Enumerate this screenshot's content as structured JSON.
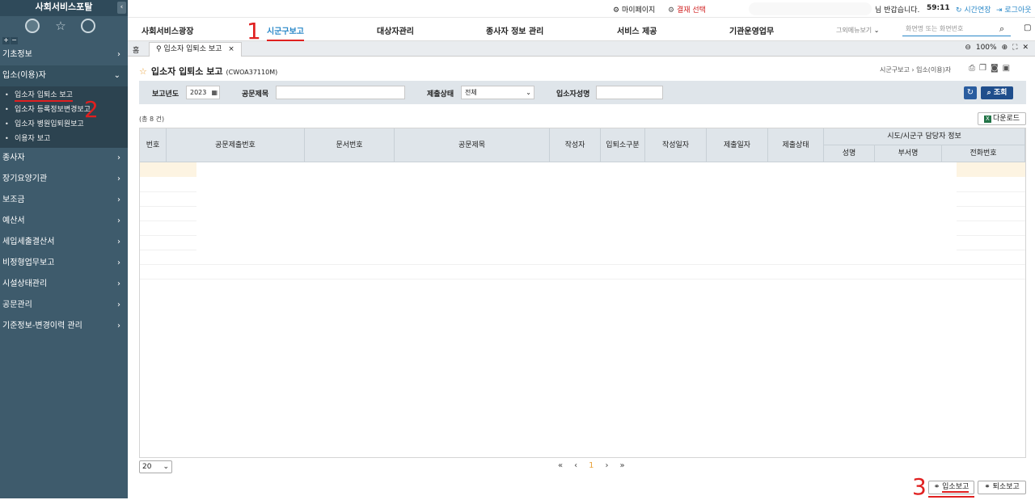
{
  "sidebar": {
    "title": "사회서비스포탈",
    "collapse_icon": "chevron-left-icon",
    "items": [
      {
        "label": "기초정보"
      },
      {
        "label": "입소(이용)자"
      },
      {
        "label": "종사자"
      },
      {
        "label": "장기요양기관"
      },
      {
        "label": "보조금"
      },
      {
        "label": "예산서"
      },
      {
        "label": "세입세출결산서"
      },
      {
        "label": "비정형업무보고"
      },
      {
        "label": "시설상태관리"
      },
      {
        "label": "공문관리"
      },
      {
        "label": "기준정보-변경이력 관리"
      }
    ],
    "subitems": [
      {
        "label": "입소자 입퇴소 보고"
      },
      {
        "label": "입소자 등록정보변경보고"
      },
      {
        "label": "입소자 병원입퇴원보고"
      },
      {
        "label": "이용자 보고"
      }
    ]
  },
  "topbar": {
    "mypage": "마이페이지",
    "approval": "결재 선택",
    "greeting": "님 반갑습니다.",
    "timer": "59:11",
    "extend": "시간연장",
    "logout": "로그아웃"
  },
  "nav": {
    "items": [
      {
        "label": "사회서비스광장"
      },
      {
        "label": "시군구보고"
      },
      {
        "label": "대상자관리"
      },
      {
        "label": "종사자 정보 관리"
      },
      {
        "label": "서비스 제공"
      },
      {
        "label": "기관운영업무"
      }
    ],
    "other": "그외메뉴보기",
    "search_placeholder": "화면명 또는 화면번호"
  },
  "tabs": {
    "home": "홈",
    "current": "입소자 입퇴소 보고",
    "zoom": "100%"
  },
  "page": {
    "title": "입소자 입퇴소 보고",
    "code": "(CWOA37110M)",
    "breadcrumb": "시군구보고  ›  입소(이용)자"
  },
  "filter": {
    "year_label": "보고년도",
    "year_value": "2023",
    "subject_label": "공문제목",
    "subject_value": "",
    "status_label": "제출상태",
    "status_value": "전체",
    "name_label": "입소자성명",
    "name_value": "",
    "search_btn": "조회"
  },
  "list": {
    "count": "(총 8 건)",
    "download": "다운로드",
    "columns": [
      "번호",
      "공문제출번호",
      "문서번호",
      "공문제목",
      "작성자",
      "입퇴소구분",
      "작성일자",
      "제출일자",
      "제출상태"
    ],
    "group_header": "시도/시군구 담당자 정보",
    "sub_columns": [
      "성명",
      "부서명",
      "전화번호"
    ]
  },
  "pager": {
    "page_size": "20",
    "current": "1"
  },
  "actions": {
    "admit": "입소보고",
    "discharge": "퇴소보고"
  },
  "annotations": {
    "a1": "1",
    "a2": "2",
    "a3": "3"
  }
}
